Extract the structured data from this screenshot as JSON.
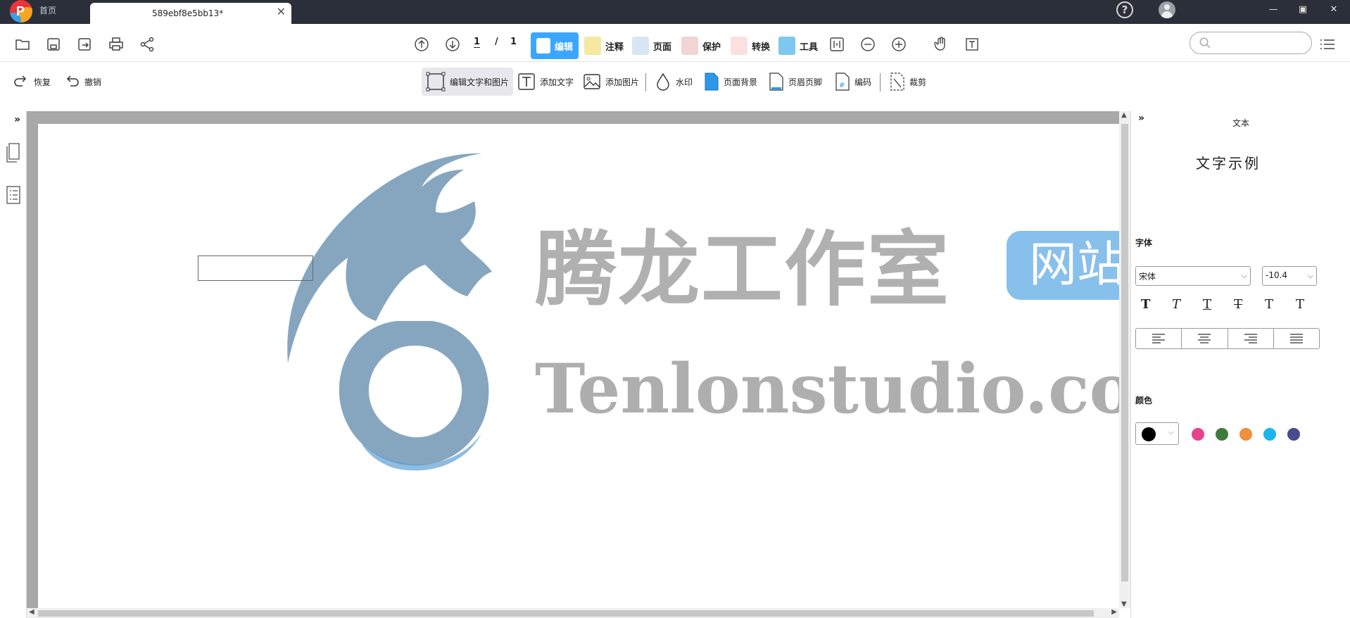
{
  "titlebar": {
    "home_tab": "首页",
    "active_tab": "589ebf8e5bb13*",
    "close_glyph": "✕",
    "help_glyph": "?",
    "minimize": "—",
    "maximize": "▣",
    "close": "✕"
  },
  "toolbar": {
    "current_page": "1",
    "page_sep": "/",
    "total_pages": "1",
    "modes": [
      {
        "label": "编辑",
        "active": true
      },
      {
        "label": "注释",
        "active": false
      },
      {
        "label": "页面",
        "active": false
      },
      {
        "label": "保护",
        "active": false
      },
      {
        "label": "转换",
        "active": false
      },
      {
        "label": "工具",
        "active": false
      }
    ],
    "search_placeholder": ""
  },
  "edit_toolbar": {
    "redo": "恢复",
    "undo": "撤销",
    "edit_text_image": "编辑文字和图片",
    "add_text": "添加文字",
    "add_image": "添加图片",
    "watermark": "水印",
    "page_background": "页面背景",
    "header_footer": "页眉页脚",
    "bates": "编码",
    "crop": "裁剪"
  },
  "document": {
    "watermark_cn": "腾龙工作室",
    "watermark_badge": "网站",
    "watermark_en": "Tenlonstudio.com"
  },
  "right_panel": {
    "title": "文本",
    "sample_text": "文字示例",
    "font_label": "字体",
    "font_value": "宋体",
    "size_value": "-10.4",
    "color_label": "颜色",
    "style_buttons": [
      "T",
      "T",
      "T",
      "T",
      "T",
      "T"
    ],
    "colors": [
      "#000000",
      "#e8428c",
      "#3f7a3a",
      "#f0903a",
      "#1ab6ee",
      "#4a4a8e"
    ]
  }
}
